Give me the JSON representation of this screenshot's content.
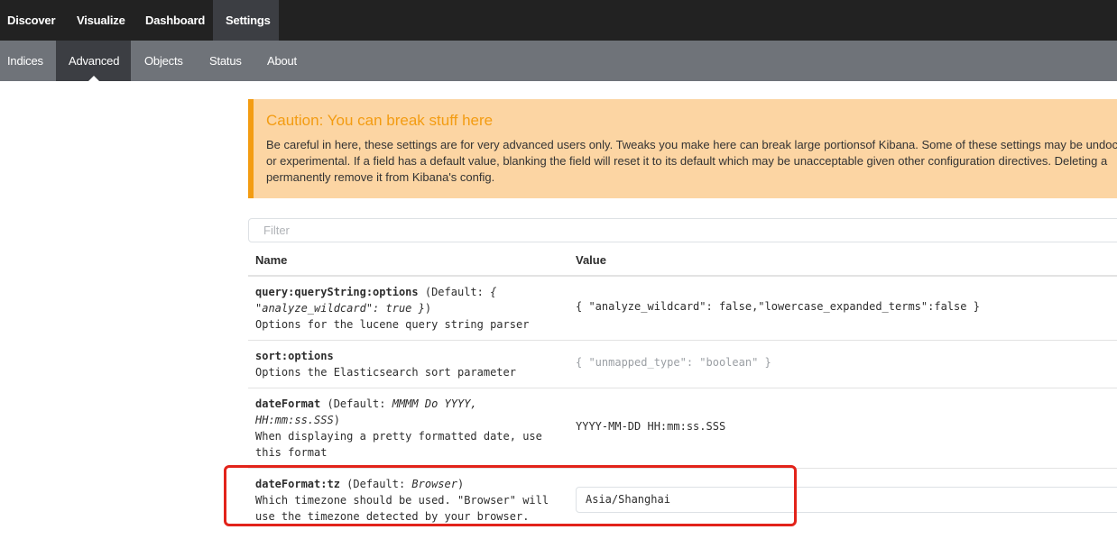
{
  "topnav": {
    "tabs": [
      "Discover",
      "Visualize",
      "Dashboard",
      "Settings"
    ],
    "active": "Settings"
  },
  "subnav": {
    "tabs": [
      "Indices",
      "Advanced",
      "Objects",
      "Status",
      "About"
    ],
    "active": "Advanced"
  },
  "caution": {
    "title": "Caution: You can break stuff here",
    "lines": [
      "Be careful in here, these settings are for very advanced users only. Tweaks you make here can break large portionsof Kibana. Some of these settings may be undoc",
      "or experimental. If a field has a default value, blanking the field will reset it to its default which may be unacceptable given other configuration directives. Deleting a",
      "permanently remove it from Kibana's config."
    ]
  },
  "filter": {
    "placeholder": "Filter"
  },
  "table": {
    "headers": {
      "name": "Name",
      "value": "Value"
    },
    "rows": [
      {
        "key": "query:queryString:options",
        "default_prefix": " (Default: ",
        "default_value": "{ \"analyze_wildcard\": true }",
        "default_suffix": ")",
        "description": "Options for the lucene query string parser",
        "value": "{ \"analyze_wildcard\": false,\"lowercase_expanded_terms\":false }"
      },
      {
        "key": "sort:options",
        "description": "Options the Elasticsearch sort parameter",
        "value": "{ \"unmapped_type\": \"boolean\" }"
      },
      {
        "key": "dateFormat",
        "default_prefix": " (Default: ",
        "default_value": "MMMM Do YYYY, HH:mm:ss.SSS",
        "default_suffix": ")",
        "description": "When displaying a pretty formatted date, use this format",
        "value": "YYYY-MM-DD HH:mm:ss.SSS"
      },
      {
        "key": "dateFormat:tz",
        "default_prefix": " (Default: ",
        "default_value": "Browser",
        "default_suffix": ")",
        "description": "Which timezone should be used. \"Browser\" will use the timezone detected by your browser.",
        "value": "Asia/Shanghai"
      }
    ]
  },
  "colors": {
    "topnav_bg": "#222222",
    "subnav_bg": "#6f7379",
    "active_tab_bg": "#3c3e43",
    "caution_bg": "#fcd5a3",
    "caution_accent": "#f39c12",
    "highlight_border": "#e2231a"
  }
}
